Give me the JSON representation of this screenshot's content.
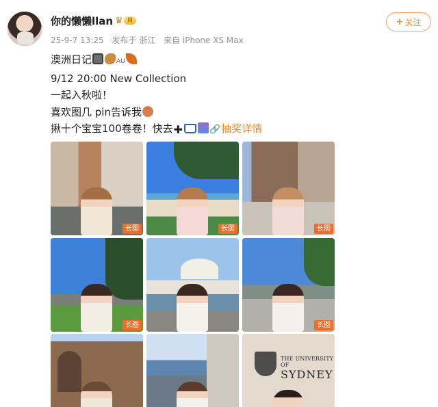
{
  "post": {
    "username": "你的懒懒llan",
    "vip_level": "II",
    "date": "25-9-7 13:25",
    "location": "发布于 浙江",
    "device": "来自 iPhone XS Max",
    "follow_label": "关注",
    "lines": {
      "l1_text": "澳洲日记",
      "l1_au": "AU",
      "l2": "9/12 20:00 New Collection",
      "l3": "一起入秋啦！",
      "l4": "喜欢图几 pin告诉我",
      "l5_text": "揪十个宝宝100卷卷！快去",
      "l5_link": "抽奖详情"
    },
    "images": [
      {
        "badge": "长图",
        "theme": "street"
      },
      {
        "badge": "长图",
        "theme": "beach"
      },
      {
        "badge": "长图",
        "theme": "arcade"
      },
      {
        "badge": "长图",
        "theme": "park"
      },
      {
        "badge": "",
        "theme": "opera"
      },
      {
        "badge": "长图",
        "theme": "bridge"
      },
      {
        "badge": "",
        "theme": "building"
      },
      {
        "badge": "",
        "theme": "harbour"
      },
      {
        "badge": "",
        "theme": "university"
      }
    ],
    "sign": {
      "university": "THE UNIVERSITY OF",
      "city": "SYDNEY"
    }
  },
  "colors": {
    "accent": "#ef8b2a",
    "badge": "#ef6c2b",
    "meta_text": "#939393"
  }
}
